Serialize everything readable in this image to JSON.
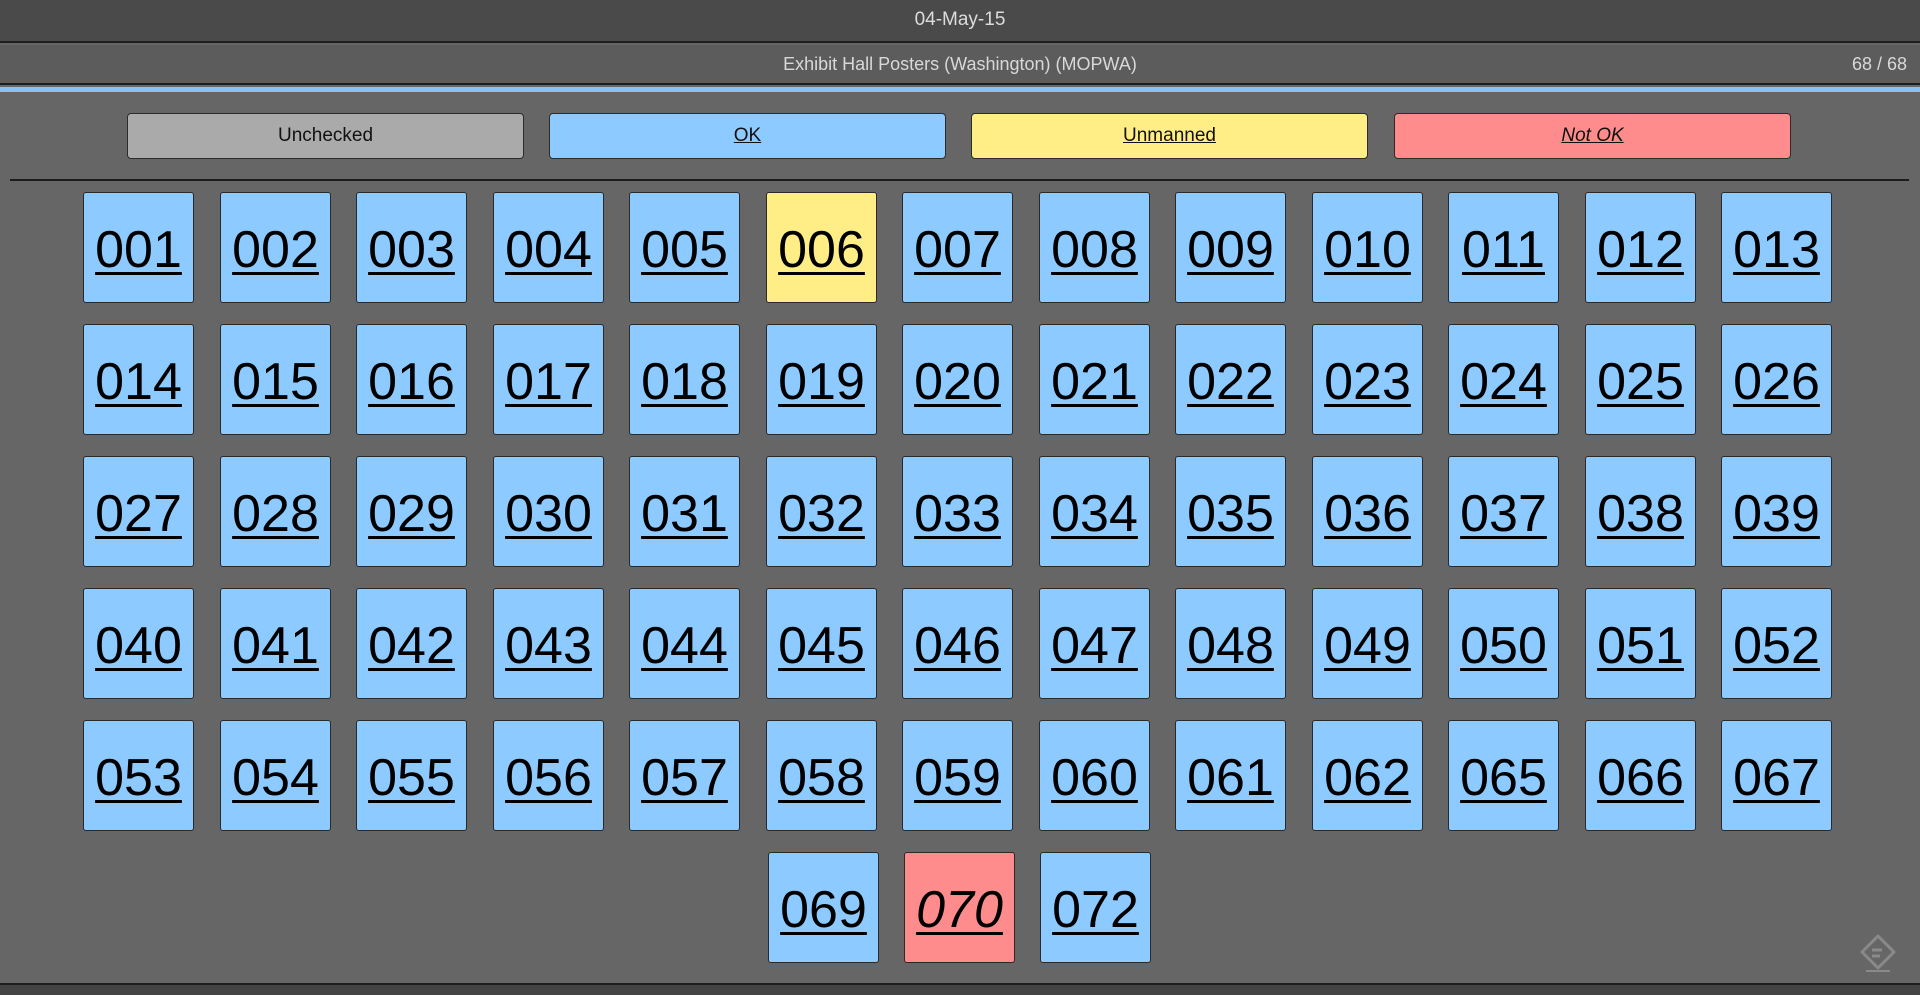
{
  "header": {
    "date": "04-May-15"
  },
  "titlebar": {
    "title": "Exhibit Hall Posters (Washington) (MOPWA)",
    "count": "68 / 68"
  },
  "legend": {
    "unchecked": "Unchecked",
    "ok": "OK",
    "unmanned": "Unmanned",
    "not_ok": "Not OK"
  },
  "colors": {
    "unchecked": "#aaaaaa",
    "ok": "#8dcaff",
    "unmanned": "#ffee86",
    "not_ok": "#ff8c8c",
    "accent": "#86c2f5"
  },
  "rows": [
    [
      {
        "label": "001",
        "status": "ok"
      },
      {
        "label": "002",
        "status": "ok"
      },
      {
        "label": "003",
        "status": "ok"
      },
      {
        "label": "004",
        "status": "ok"
      },
      {
        "label": "005",
        "status": "ok"
      },
      {
        "label": "006",
        "status": "unmanned"
      },
      {
        "label": "007",
        "status": "ok"
      },
      {
        "label": "008",
        "status": "ok"
      },
      {
        "label": "009",
        "status": "ok"
      },
      {
        "label": "010",
        "status": "ok"
      },
      {
        "label": "011",
        "status": "ok"
      },
      {
        "label": "012",
        "status": "ok"
      },
      {
        "label": "013",
        "status": "ok"
      }
    ],
    [
      {
        "label": "014",
        "status": "ok"
      },
      {
        "label": "015",
        "status": "ok"
      },
      {
        "label": "016",
        "status": "ok"
      },
      {
        "label": "017",
        "status": "ok"
      },
      {
        "label": "018",
        "status": "ok"
      },
      {
        "label": "019",
        "status": "ok"
      },
      {
        "label": "020",
        "status": "ok"
      },
      {
        "label": "021",
        "status": "ok"
      },
      {
        "label": "022",
        "status": "ok"
      },
      {
        "label": "023",
        "status": "ok"
      },
      {
        "label": "024",
        "status": "ok"
      },
      {
        "label": "025",
        "status": "ok"
      },
      {
        "label": "026",
        "status": "ok"
      }
    ],
    [
      {
        "label": "027",
        "status": "ok"
      },
      {
        "label": "028",
        "status": "ok"
      },
      {
        "label": "029",
        "status": "ok"
      },
      {
        "label": "030",
        "status": "ok"
      },
      {
        "label": "031",
        "status": "ok"
      },
      {
        "label": "032",
        "status": "ok"
      },
      {
        "label": "033",
        "status": "ok"
      },
      {
        "label": "034",
        "status": "ok"
      },
      {
        "label": "035",
        "status": "ok"
      },
      {
        "label": "036",
        "status": "ok"
      },
      {
        "label": "037",
        "status": "ok"
      },
      {
        "label": "038",
        "status": "ok"
      },
      {
        "label": "039",
        "status": "ok"
      }
    ],
    [
      {
        "label": "040",
        "status": "ok"
      },
      {
        "label": "041",
        "status": "ok"
      },
      {
        "label": "042",
        "status": "ok"
      },
      {
        "label": "043",
        "status": "ok"
      },
      {
        "label": "044",
        "status": "ok"
      },
      {
        "label": "045",
        "status": "ok"
      },
      {
        "label": "046",
        "status": "ok"
      },
      {
        "label": "047",
        "status": "ok"
      },
      {
        "label": "048",
        "status": "ok"
      },
      {
        "label": "049",
        "status": "ok"
      },
      {
        "label": "050",
        "status": "ok"
      },
      {
        "label": "051",
        "status": "ok"
      },
      {
        "label": "052",
        "status": "ok"
      }
    ],
    [
      {
        "label": "053",
        "status": "ok"
      },
      {
        "label": "054",
        "status": "ok"
      },
      {
        "label": "055",
        "status": "ok"
      },
      {
        "label": "056",
        "status": "ok"
      },
      {
        "label": "057",
        "status": "ok"
      },
      {
        "label": "058",
        "status": "ok"
      },
      {
        "label": "059",
        "status": "ok"
      },
      {
        "label": "060",
        "status": "ok"
      },
      {
        "label": "061",
        "status": "ok"
      },
      {
        "label": "062",
        "status": "ok"
      },
      {
        "label": "065",
        "status": "ok"
      },
      {
        "label": "066",
        "status": "ok"
      },
      {
        "label": "067",
        "status": "ok"
      }
    ],
    [
      {
        "label": "069",
        "status": "ok"
      },
      {
        "label": "070",
        "status": "notok"
      },
      {
        "label": "072",
        "status": "ok"
      }
    ]
  ],
  "corner_icon": "feed-icon"
}
